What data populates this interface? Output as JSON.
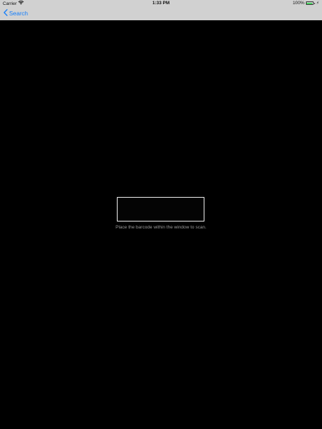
{
  "status_bar": {
    "carrier": "Carrier",
    "time": "1:33 PM",
    "battery": "100%",
    "icons": [
      "wifi-icon",
      "battery-icon",
      "charging-icon"
    ]
  },
  "nav": {
    "back_label": "Search"
  },
  "scanner": {
    "hint": "Place the barcode within the window to scan."
  },
  "colors": {
    "accent": "#147efb",
    "background": "#000000",
    "bar": "#d1d1d1"
  }
}
